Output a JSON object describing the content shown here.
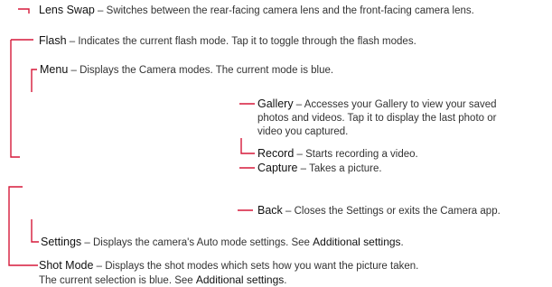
{
  "accent_color": "#d6193a",
  "callouts": {
    "lens_swap": {
      "term": "Lens Swap",
      "desc": " – Switches between the rear-facing camera lens and the front-facing camera lens."
    },
    "flash": {
      "term": "Flash",
      "desc": " – Indicates the current flash mode. Tap it to toggle through the flash modes."
    },
    "menu": {
      "term": "Menu",
      "desc": " – Displays the Camera modes. The current mode is blue."
    },
    "gallery": {
      "term": "Gallery",
      "desc_line1": " – Accesses your Gallery to view your saved",
      "desc_line2": "photos and videos. Tap it to display the last photo or",
      "desc_line3": "video you captured."
    },
    "record": {
      "term": "Record",
      "desc": " – Starts recording a video."
    },
    "capture": {
      "term": "Capture",
      "desc": " – Takes a picture."
    },
    "back": {
      "term": "Back",
      "desc": " – Closes the Settings or exits the Camera app."
    },
    "settings": {
      "term": "Settings",
      "desc": " – Displays the camera's Auto mode settings. See ",
      "link": "Additional settings",
      "tail": "."
    },
    "shot_mode": {
      "term": "Shot Mode",
      "desc_line1": " – Displays the shot modes which sets how you want the picture taken.",
      "desc_line2": "The current selection is blue. See ",
      "link": "Additional settings",
      "tail": "."
    }
  }
}
